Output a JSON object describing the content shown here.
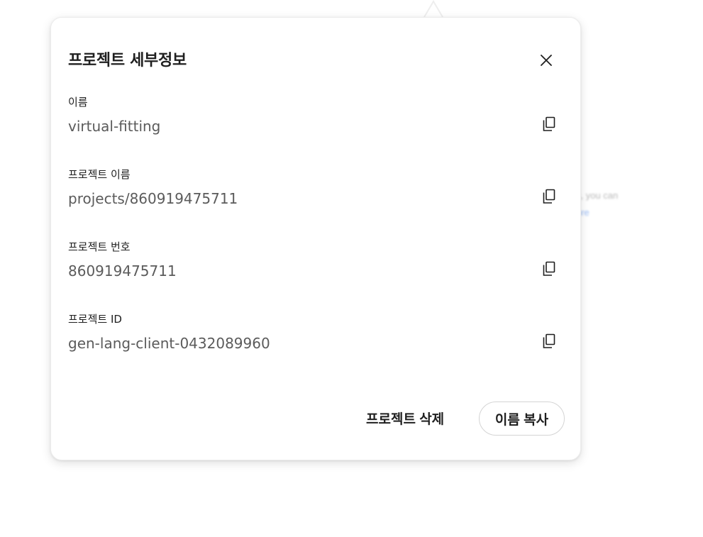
{
  "background": {
    "text_line1": "s, you can",
    "text_link": "ore"
  },
  "dialog": {
    "title": "프로젝트 세부정보",
    "close_icon": "close-icon",
    "fields": [
      {
        "label": "이름",
        "value": "virtual-fitting"
      },
      {
        "label": "프로젝트 이름",
        "value": "projects/860919475711"
      },
      {
        "label": "프로젝트 번호",
        "value": "860919475711"
      },
      {
        "label": "프로젝트 ID",
        "value": "gen-lang-client-0432089960"
      }
    ],
    "copy_icon": "copy-icon",
    "delete_label": "프로젝트 삭제",
    "copy_name_label": "이름 복사"
  },
  "colors": {
    "text_primary": "#1f1f1f",
    "text_secondary": "#5b5b5b",
    "border": "#d4d4d4",
    "link": "#9bbcf5"
  }
}
